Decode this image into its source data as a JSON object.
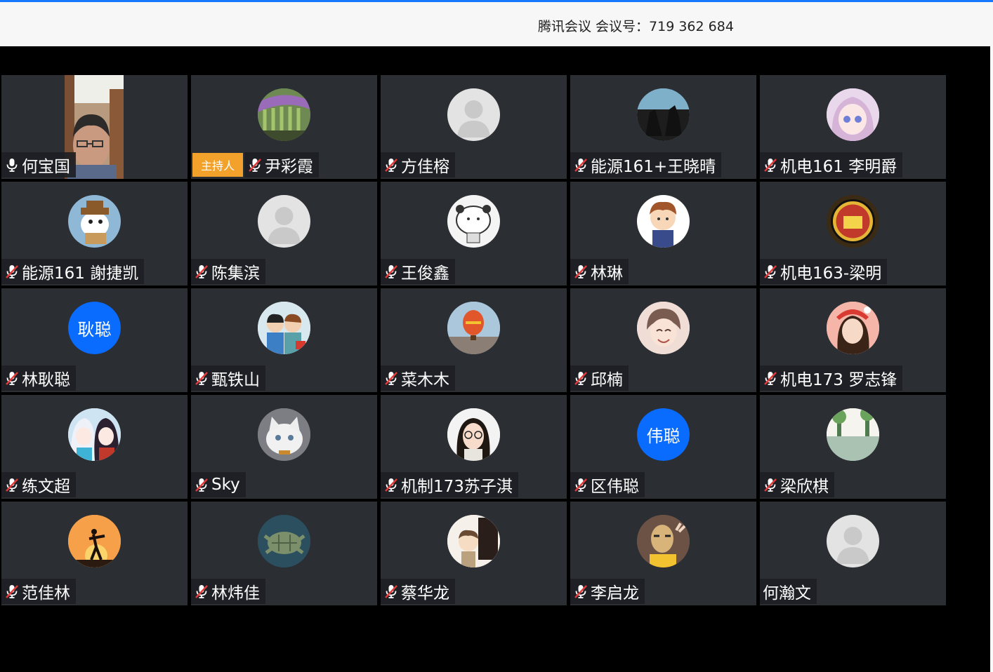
{
  "window": {
    "title": "腾讯会议 会议号：719 362 684"
  },
  "host_badge": "主持人",
  "participants": [
    {
      "name": "何宝国",
      "mic": "on",
      "avatar": "video"
    },
    {
      "name": "尹彩霞",
      "mic": "muted",
      "avatar": "wisteria-photo"
    },
    {
      "name": "方佳榕",
      "mic": "muted",
      "avatar": "default-user"
    },
    {
      "name": "能源161+王晓晴",
      "mic": "muted",
      "avatar": "horse-riders"
    },
    {
      "name": "机电161 李明爵",
      "mic": "muted",
      "avatar": "anime-girl"
    },
    {
      "name": "能源161 謝捷凯",
      "mic": "muted",
      "avatar": "cartoon-dog"
    },
    {
      "name": "陈集滨",
      "mic": "muted",
      "avatar": "default-user"
    },
    {
      "name": "王俊鑫",
      "mic": "muted",
      "avatar": "bear-drawing"
    },
    {
      "name": "林琳",
      "mic": "muted",
      "avatar": "cartoon-boy"
    },
    {
      "name": "机电163-梁明",
      "mic": "muted",
      "avatar": "club-crest"
    },
    {
      "name": "林耿聪",
      "mic": "muted",
      "avatar": "text",
      "avatar_text": "耿聪"
    },
    {
      "name": "甄铁山",
      "mic": "muted",
      "avatar": "cartoon-kids"
    },
    {
      "name": "菜木木",
      "mic": "muted",
      "avatar": "hot-air-balloon"
    },
    {
      "name": "邱楠",
      "mic": "muted",
      "avatar": "smiling-boy"
    },
    {
      "name": "机电173 罗志锋",
      "mic": "muted",
      "avatar": "girl-photo"
    },
    {
      "name": "练文超",
      "mic": "muted",
      "avatar": "anime-duo"
    },
    {
      "name": "Sky",
      "mic": "muted",
      "avatar": "white-cat"
    },
    {
      "name": "机制173苏子淇",
      "mic": "muted",
      "avatar": "girl-glasses"
    },
    {
      "name": "区伟聪",
      "mic": "muted",
      "avatar": "text",
      "avatar_text": "伟聪"
    },
    {
      "name": "梁欣棋",
      "mic": "muted",
      "avatar": "flooded-street"
    },
    {
      "name": "范佳林",
      "mic": "muted",
      "avatar": "sunset-silhouette"
    },
    {
      "name": "林炜佳",
      "mic": "muted",
      "avatar": "sea-turtle"
    },
    {
      "name": "蔡华龙",
      "mic": "muted",
      "avatar": "chibi-couple"
    },
    {
      "name": "李启龙",
      "mic": "muted",
      "avatar": "masked-person"
    },
    {
      "name": "何瀚文",
      "mic": "none",
      "avatar": "default-user"
    }
  ],
  "colors": {
    "accent": "#1677ff",
    "tile": "#2b2e33",
    "host": "#f2a12a",
    "text_avatar": "#0a6cff"
  }
}
